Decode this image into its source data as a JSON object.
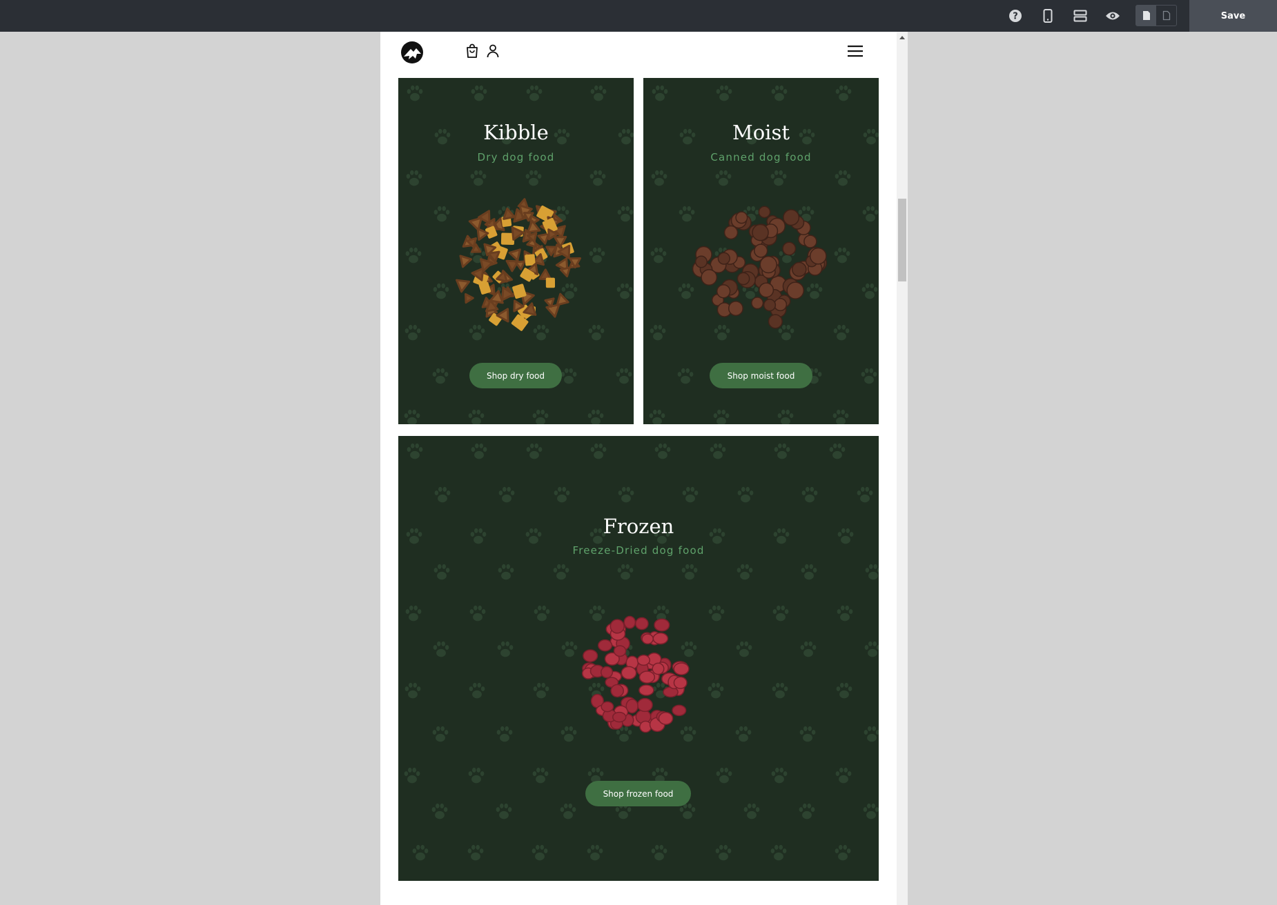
{
  "toolbar": {
    "icons": [
      "help-icon",
      "mobile-view-icon",
      "sections-icon",
      "preview-eye-icon"
    ],
    "view_toggle": [
      "page-solid-icon",
      "page-outline-icon"
    ],
    "save_label": "Save"
  },
  "site_header": {
    "icons": [
      "logo-icon",
      "cart-icon",
      "user-icon",
      "hamburger-menu-icon"
    ]
  },
  "products": [
    {
      "title": "Kibble",
      "subtitle": "Dry dog food",
      "button": "Shop dry food",
      "image": "dry-kibble-pile"
    },
    {
      "title": "Moist",
      "subtitle": "Canned dog food",
      "button": "Shop moist food",
      "image": "moist-food-pile"
    },
    {
      "title": "Frozen",
      "subtitle": "Freeze-Dried dog food",
      "button": "Shop frozen food",
      "image": "freeze-dried-pile"
    }
  ],
  "colors": {
    "topbar": "#2b2f35",
    "card_bg": "#1f2e21",
    "subtitle": "#5fa26b",
    "button": "#3f6f42",
    "kibble_dark": "#7a4a26",
    "kibble_light": "#d8a034",
    "moist": "#5a3324",
    "frozen": "#a02a3a"
  }
}
